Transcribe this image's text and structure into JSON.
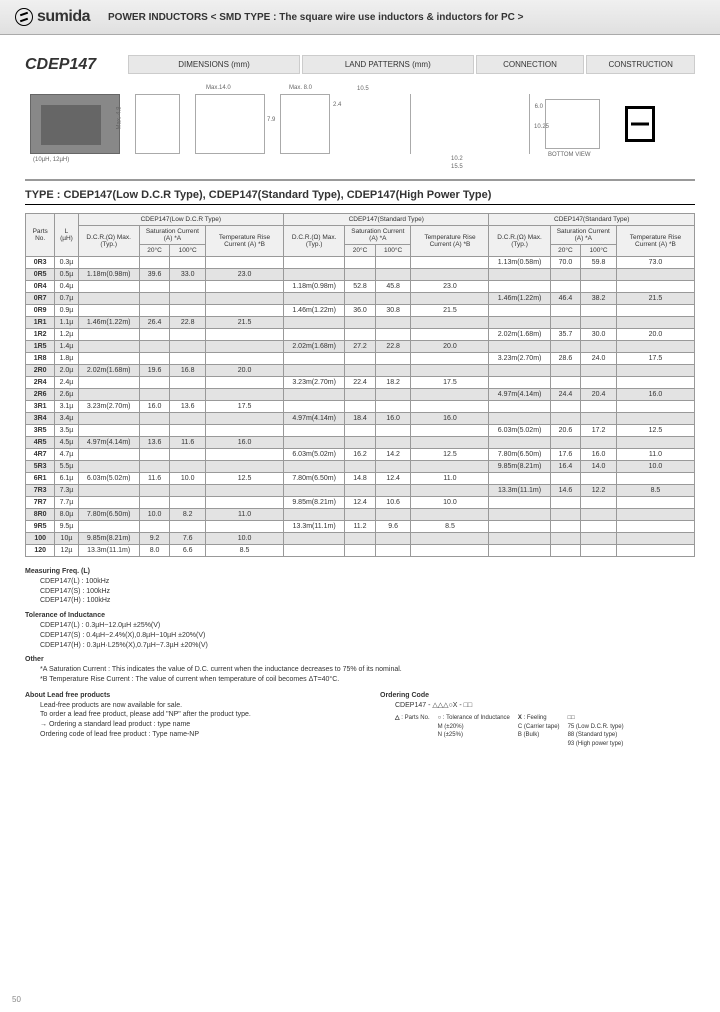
{
  "header": {
    "logo_text": "sumida",
    "title": "POWER INDUCTORS < SMD TYPE : The square wire use inductors & inductors for PC >"
  },
  "part": {
    "title": "CDEP147",
    "sections": [
      "DIMENSIONS (mm)",
      "LAND PATTERNS (mm)",
      "CONNECTION",
      "CONSTRUCTION"
    ],
    "drawing_labels": {
      "photo": "(10µH, 12µH)",
      "d1_h": "Max. 4.8",
      "d2_w": "Max.14.0",
      "d3_w": "Max. 8.0",
      "d3_h": "7.9",
      "d4_w": "10.5",
      "d4_h": "2.4",
      "lp1": "6.0",
      "lp2": "10.25",
      "lp3": "10.2",
      "lp4": "15.5",
      "conn": "BOTTOM VIEW"
    }
  },
  "type_heading": "TYPE : CDEP147(Low D.C.R Type), CDEP147(Standard Type), CDEP147(High Power Type)",
  "group_headers": [
    "CDEP147(Low D.C.R Type)",
    "CDEP147(Standard Type)",
    "CDEP147(Standard Type)"
  ],
  "col_headers": {
    "parts": "Parts No.",
    "l": "L (µH)",
    "dcr": "D.C.R.(Ω) Max.(Typ.)",
    "sat": "Saturation Current (A) *A",
    "sat20": "20°C",
    "sat100": "100°C",
    "trc": "Temperature Rise Current (A) *B"
  },
  "rows": [
    {
      "pn": "0R3",
      "l": "0.3µ",
      "a": [
        "",
        "",
        "",
        ""
      ],
      "b": [
        "",
        "",
        "",
        ""
      ],
      "c": [
        "1.13m(0.58m)",
        "70.0",
        "59.8",
        "73.0"
      ]
    },
    {
      "pn": "0R5",
      "l": "0.5µ",
      "a": [
        "1.18m(0.98m)",
        "39.6",
        "33.0",
        "23.0"
      ],
      "b": [
        "",
        "",
        "",
        ""
      ],
      "c": [
        "",
        "",
        "",
        ""
      ]
    },
    {
      "pn": "0R4",
      "l": "0.4µ",
      "a": [
        "",
        "",
        "",
        ""
      ],
      "b": [
        "1.18m(0.98m)",
        "52.8",
        "45.8",
        "23.0"
      ],
      "c": [
        "",
        "",
        "",
        ""
      ]
    },
    {
      "pn": "0R7",
      "l": "0.7µ",
      "a": [
        "",
        "",
        "",
        ""
      ],
      "b": [
        "",
        "",
        "",
        ""
      ],
      "c": [
        "1.46m(1.22m)",
        "46.4",
        "38.2",
        "21.5"
      ]
    },
    {
      "pn": "0R9",
      "l": "0.9µ",
      "a": [
        "",
        "",
        "",
        ""
      ],
      "b": [
        "1.46m(1.22m)",
        "36.0",
        "30.8",
        "21.5"
      ],
      "c": [
        "",
        "",
        "",
        ""
      ]
    },
    {
      "pn": "1R1",
      "l": "1.1µ",
      "a": [
        "1.46m(1.22m)",
        "26.4",
        "22.8",
        "21.5"
      ],
      "b": [
        "",
        "",
        "",
        ""
      ],
      "c": [
        "",
        "",
        "",
        ""
      ]
    },
    {
      "pn": "1R2",
      "l": "1.2µ",
      "a": [
        "",
        "",
        "",
        ""
      ],
      "b": [
        "",
        "",
        "",
        ""
      ],
      "c": [
        "2.02m(1.68m)",
        "35.7",
        "30.0",
        "20.0"
      ]
    },
    {
      "pn": "1R5",
      "l": "1.4µ",
      "a": [
        "",
        "",
        "",
        ""
      ],
      "b": [
        "2.02m(1.68m)",
        "27.2",
        "22.8",
        "20.0"
      ],
      "c": [
        "",
        "",
        "",
        ""
      ]
    },
    {
      "pn": "1R8",
      "l": "1.8µ",
      "a": [
        "",
        "",
        "",
        ""
      ],
      "b": [
        "",
        "",
        "",
        ""
      ],
      "c": [
        "3.23m(2.70m)",
        "28.6",
        "24.0",
        "17.5"
      ]
    },
    {
      "pn": "2R0",
      "l": "2.0µ",
      "a": [
        "2.02m(1.68m)",
        "19.6",
        "16.8",
        "20.0"
      ],
      "b": [
        "",
        "",
        "",
        ""
      ],
      "c": [
        "",
        "",
        "",
        ""
      ]
    },
    {
      "pn": "2R4",
      "l": "2.4µ",
      "a": [
        "",
        "",
        "",
        ""
      ],
      "b": [
        "3.23m(2.70m)",
        "22.4",
        "18.2",
        "17.5"
      ],
      "c": [
        "",
        "",
        "",
        ""
      ]
    },
    {
      "pn": "2R6",
      "l": "2.6µ",
      "a": [
        "",
        "",
        "",
        ""
      ],
      "b": [
        "",
        "",
        "",
        ""
      ],
      "c": [
        "4.97m(4.14m)",
        "24.4",
        "20.4",
        "16.0"
      ]
    },
    {
      "pn": "3R1",
      "l": "3.1µ",
      "a": [
        "3.23m(2.70m)",
        "16.0",
        "13.6",
        "17.5"
      ],
      "b": [
        "",
        "",
        "",
        ""
      ],
      "c": [
        "",
        "",
        "",
        ""
      ]
    },
    {
      "pn": "3R4",
      "l": "3.4µ",
      "a": [
        "",
        "",
        "",
        ""
      ],
      "b": [
        "4.97m(4.14m)",
        "18.4",
        "16.0",
        "16.0"
      ],
      "c": [
        "",
        "",
        "",
        ""
      ]
    },
    {
      "pn": "3R5",
      "l": "3.5µ",
      "a": [
        "",
        "",
        "",
        ""
      ],
      "b": [
        "",
        "",
        "",
        ""
      ],
      "c": [
        "6.03m(5.02m)",
        "20.6",
        "17.2",
        "12.5"
      ]
    },
    {
      "pn": "4R5",
      "l": "4.5µ",
      "a": [
        "4.97m(4.14m)",
        "13.6",
        "11.6",
        "16.0"
      ],
      "b": [
        "",
        "",
        "",
        ""
      ],
      "c": [
        "",
        "",
        "",
        ""
      ]
    },
    {
      "pn": "4R7",
      "l": "4.7µ",
      "a": [
        "",
        "",
        "",
        ""
      ],
      "b": [
        "6.03m(5.02m)",
        "16.2",
        "14.2",
        "12.5"
      ],
      "c": [
        "7.80m(6.50m)",
        "17.6",
        "16.0",
        "11.0"
      ]
    },
    {
      "pn": "5R3",
      "l": "5.5µ",
      "a": [
        "",
        "",
        "",
        ""
      ],
      "b": [
        "",
        "",
        "",
        ""
      ],
      "c": [
        "9.85m(8.21m)",
        "16.4",
        "14.0",
        "10.0"
      ]
    },
    {
      "pn": "6R1",
      "l": "6.1µ",
      "a": [
        "6.03m(5.02m)",
        "11.6",
        "10.0",
        "12.5"
      ],
      "b": [
        "7.80m(6.50m)",
        "14.8",
        "12.4",
        "11.0"
      ],
      "c": [
        "",
        "",
        "",
        ""
      ]
    },
    {
      "pn": "7R3",
      "l": "7.3µ",
      "a": [
        "",
        "",
        "",
        ""
      ],
      "b": [
        "",
        "",
        "",
        ""
      ],
      "c": [
        "13.3m(11.1m)",
        "14.6",
        "12.2",
        "8.5"
      ]
    },
    {
      "pn": "7R7",
      "l": "7.7µ",
      "a": [
        "",
        "",
        "",
        ""
      ],
      "b": [
        "9.85m(8.21m)",
        "12.4",
        "10.6",
        "10.0"
      ],
      "c": [
        "",
        "",
        "",
        ""
      ]
    },
    {
      "pn": "8R0",
      "l": "8.0µ",
      "a": [
        "7.80m(6.50m)",
        "10.0",
        "8.2",
        "11.0"
      ],
      "b": [
        "",
        "",
        "",
        ""
      ],
      "c": [
        "",
        "",
        "",
        ""
      ]
    },
    {
      "pn": "9R5",
      "l": "9.5µ",
      "a": [
        "",
        "",
        "",
        ""
      ],
      "b": [
        "13.3m(11.1m)",
        "11.2",
        "9.6",
        "8.5"
      ],
      "c": [
        "",
        "",
        "",
        ""
      ]
    },
    {
      "pn": "100",
      "l": "10µ",
      "a": [
        "9.85m(8.21m)",
        "9.2",
        "7.6",
        "10.0"
      ],
      "b": [
        "",
        "",
        "",
        ""
      ],
      "c": [
        "",
        "",
        "",
        ""
      ]
    },
    {
      "pn": "120",
      "l": "12µ",
      "a": [
        "13.3m(11.1m)",
        "8.0",
        "6.6",
        "8.5"
      ],
      "b": [
        "",
        "",
        "",
        ""
      ],
      "c": [
        "",
        "",
        "",
        ""
      ]
    }
  ],
  "notes": {
    "mf_title": "Measuring Freq. (L)",
    "mf": [
      "CDEP147(L) : 100kHz",
      "CDEP147(S) : 100kHz",
      "CDEP147(H) : 100kHz"
    ],
    "tol_title": "Tolerance of Inductance",
    "tol": [
      "CDEP147(L) : 0.3µH~12.0µH ±25%(V)",
      "CDEP147(S) : 0.4µH~2.4%(X),0.8µH~10µH ±20%(V)",
      "CDEP147(H) : 0.3µH·L25%(X),0.7µH~7.3µH ±20%(V)"
    ],
    "other_title": "Other",
    "other": [
      "*A Saturation Current : This indicates the value of D.C. current when the inductance decreases to 75% of its nominal.",
      "*B Temperature Rise Current : The value of current when temperature of coil becomes ΔT=40°C."
    ],
    "lf_title": "About Lead free products",
    "lf": [
      "Lead-free products are now available for sale.",
      "To order a lead free product, please add \"NP\" after the product type.",
      "→ Ordering a standard lead product : type name",
      "  Ordering code of lead free product : Type name-NP"
    ],
    "oc_title": "Ordering Code",
    "oc_format": "CDEP147 - △△△○X - □□",
    "oc_parts": [
      {
        "sym": "△",
        "label": ": Parts No.",
        "desc": ""
      },
      {
        "sym": "○",
        "label": ": Tolerance of Inductance",
        "desc": "M (±20%)\nN (±25%)"
      },
      {
        "sym": "X",
        "label": ": Feeling",
        "desc": "C (Carrier tape)\nB (Bulk)"
      },
      {
        "sym": "□□",
        "label": "",
        "desc": "75 (Low D.C.R. type)\n88 (Standard type)\n93 (High power type)"
      }
    ]
  },
  "page_number": "50"
}
